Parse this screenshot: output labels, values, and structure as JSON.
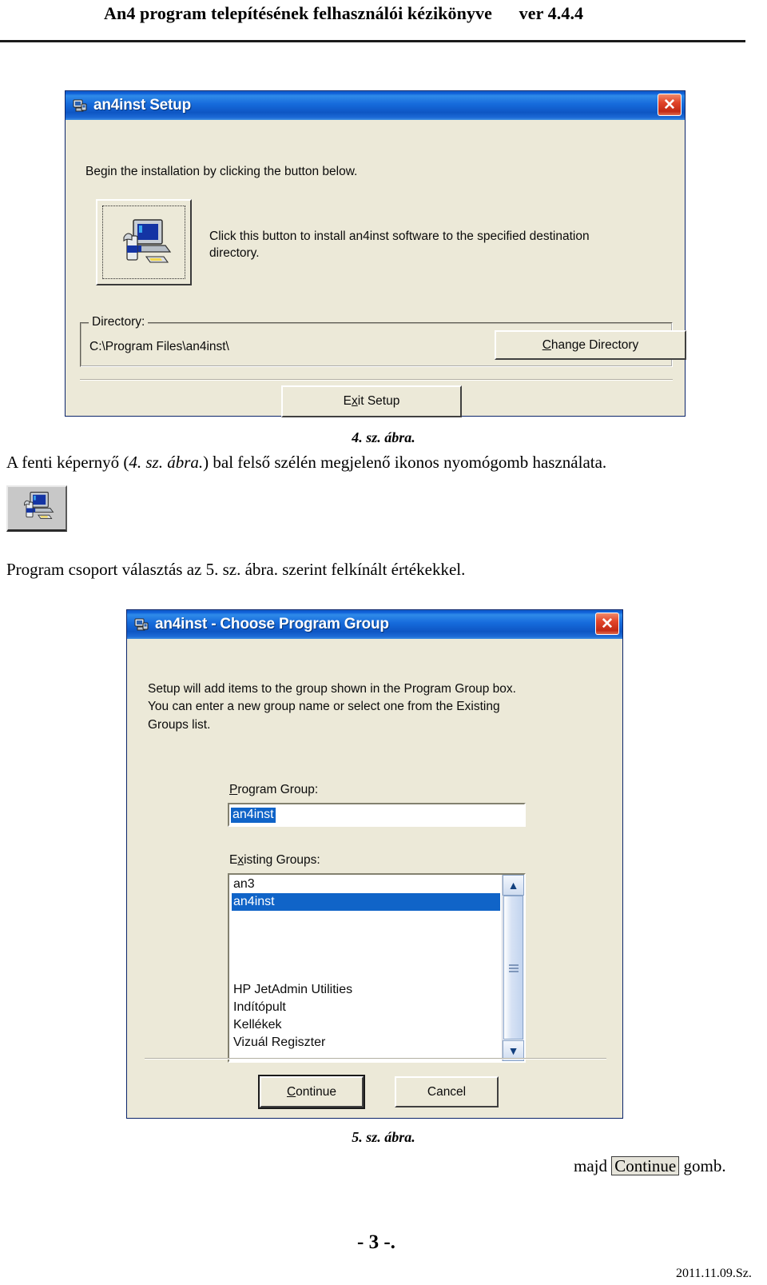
{
  "document": {
    "header_title": "An4 program telepítésének felhasználói kézikönyve      ver 4.4.4",
    "page_number": "- 3 -.",
    "footer_date": "2011.11.09.Sz."
  },
  "figure4": {
    "dialog": {
      "title": "an4inst Setup",
      "title_icon": "setup-package-icon",
      "close_label": "✕",
      "intro": "Begin the installation by clicking the button below.",
      "install_button_icon": "computer-install-icon",
      "install_description": "Click this button to install an4inst software to the specified destination directory.",
      "directory_group_label": "Directory:",
      "directory_path": "C:\\Program Files\\an4inst\\",
      "change_directory": {
        "prefix": "",
        "accel": "C",
        "suffix": "hange Directory"
      },
      "exit_setup": {
        "prefix": "E",
        "accel": "x",
        "suffix": "it Setup"
      }
    },
    "caption": "4. sz. ábra."
  },
  "body_text": {
    "paragraph1_pre": "A fenti képernyő (",
    "paragraph1_italic": "4. sz. ábra.",
    "paragraph1_post": ") bal felső szélén megjelenő ikonos nyomógomb használata.",
    "inline_icon": "computer-install-icon",
    "paragraph2": "Program csoport választás az 5. sz. ábra. szerint felkínált értékekkel.",
    "closing_pre": "majd ",
    "closing_chip": "Continue",
    "closing_post": " gomb."
  },
  "figure5": {
    "dialog": {
      "title": "an4inst - Choose Program Group",
      "title_icon": "setup-package-icon",
      "close_label": "✕",
      "intro_line1": "Setup will add items to the group shown in the Program Group box.",
      "intro_line2": "You can enter a new group name or select one from the Existing",
      "intro_line3": "Groups list.",
      "program_group_label": {
        "accel": "P",
        "suffix": "rogram Group:"
      },
      "program_group_value": "an4inst",
      "existing_groups_label": {
        "prefix": "E",
        "accel": "x",
        "suffix": "isting Groups:"
      },
      "existing_groups": [
        {
          "label": "an3",
          "selected": false
        },
        {
          "label": "an4inst",
          "selected": true
        },
        {
          "label": "",
          "selected": false
        },
        {
          "label": "",
          "selected": false
        },
        {
          "label": "",
          "selected": false
        },
        {
          "label": "",
          "selected": false
        },
        {
          "label": "HP JetAdmin Utilities",
          "selected": false
        },
        {
          "label": "Indítópult",
          "selected": false
        },
        {
          "label": "Kellékek",
          "selected": false
        },
        {
          "label": "Vizuál Regiszter",
          "selected": false
        }
      ],
      "scroll_up_icon": "chevron-up-icon",
      "scroll_down_icon": "chevron-down-icon",
      "continue_button": {
        "accel": "C",
        "suffix": "ontinue"
      },
      "cancel_button": "Cancel"
    },
    "caption": "5. sz. ábra."
  },
  "colors": {
    "titlebar_blue": "#0b5ad6",
    "dialog_face": "#ece9d8",
    "selection_blue": "#1064c8",
    "close_red": "#c22a15"
  }
}
